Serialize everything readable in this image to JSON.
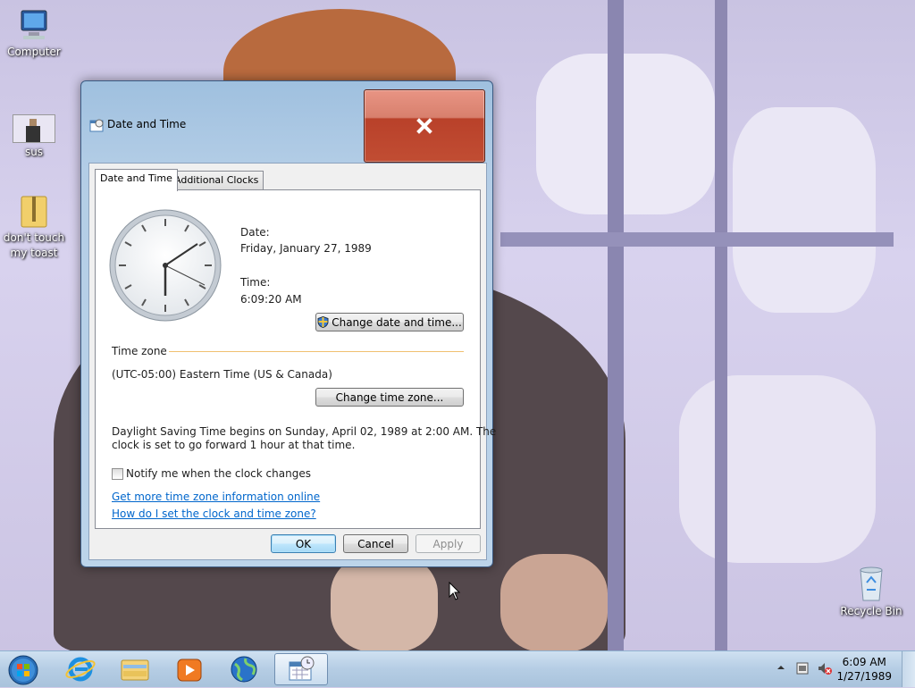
{
  "desktop": {
    "icons": [
      {
        "label": "Computer",
        "icon": "computer-icon"
      },
      {
        "label": "sus",
        "icon": "image-file-icon"
      },
      {
        "label": "don't touch my toast",
        "icon": "zip-folder-icon"
      },
      {
        "label": "Recycle Bin",
        "icon": "recycle-bin-icon"
      }
    ]
  },
  "dialog": {
    "title": "Date and Time",
    "tabs": [
      "Date and Time",
      "Additional Clocks"
    ],
    "date_label": "Date:",
    "date_value": "Friday, January 27, 1989",
    "time_label": "Time:",
    "time_value": "6:09:20 AM",
    "change_date_button": "Change date and time...",
    "timezone_header": "Time zone",
    "timezone_value": "(UTC-05:00) Eastern Time (US & Canada)",
    "change_timezone_button": "Change time zone...",
    "dst_line1": "Daylight Saving Time begins on Sunday, April 02, 1989 at 2:00 AM. The",
    "dst_line2": "clock is set to go forward 1 hour at that time.",
    "notify_checkbox": "Notify me when the clock changes",
    "notify_checked": false,
    "link1": "Get more time zone information online",
    "link2": "How do I set the clock and time zone?",
    "ok": "OK",
    "cancel": "Cancel",
    "apply": "Apply"
  },
  "taskbar": {
    "items": [
      "start-orb-icon",
      "internet-explorer-icon",
      "file-explorer-icon",
      "media-player-icon",
      "globe-icon",
      "date-time-app-icon"
    ],
    "clock_time": "6:09 AM",
    "clock_date": "1/27/1989"
  },
  "colors": {
    "close_button": "#c14d33",
    "link": "#0066cc",
    "timezone_rule": "#f0c070"
  }
}
